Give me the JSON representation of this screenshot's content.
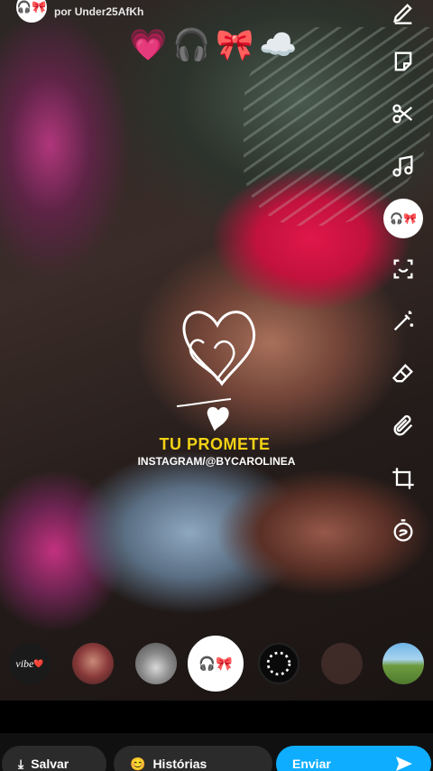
{
  "header": {
    "author_prefix": "por",
    "author": "Under25AfKh",
    "avatar_emoji": "🎧🎀"
  },
  "stickers": [
    "💗",
    "🎧",
    "🎀",
    "☁️"
  ],
  "tools": [
    {
      "name": "pencil-icon"
    },
    {
      "name": "sticker-icon"
    },
    {
      "name": "scissors-icon"
    },
    {
      "name": "music-note-icon"
    },
    {
      "name": "lens-headphones-icon",
      "label": "🎧🎀"
    },
    {
      "name": "scan-icon"
    },
    {
      "name": "magic-wand-icon"
    },
    {
      "name": "eraser-icon"
    },
    {
      "name": "paperclip-icon"
    },
    {
      "name": "crop-icon"
    },
    {
      "name": "timer-icon"
    }
  ],
  "caption": {
    "line1": "TU PROMETE",
    "line2": "INSTAGRAM/@BYCAROLINEA"
  },
  "lenses": [
    {
      "name": "lens-vibe",
      "label": "vibe",
      "emoji": "❤️"
    },
    {
      "name": "lens-face"
    },
    {
      "name": "lens-car"
    },
    {
      "name": "lens-selected",
      "label": "🎧🎀"
    },
    {
      "name": "lens-loading"
    },
    {
      "name": "lens-dark"
    },
    {
      "name": "lens-landscape"
    }
  ],
  "bottom": {
    "save_label": "Salvar",
    "story_label": "Histórias",
    "send_label": "Enviar"
  },
  "colors": {
    "caption_yellow": "#f3d215",
    "send_blue": "#0fadff"
  }
}
